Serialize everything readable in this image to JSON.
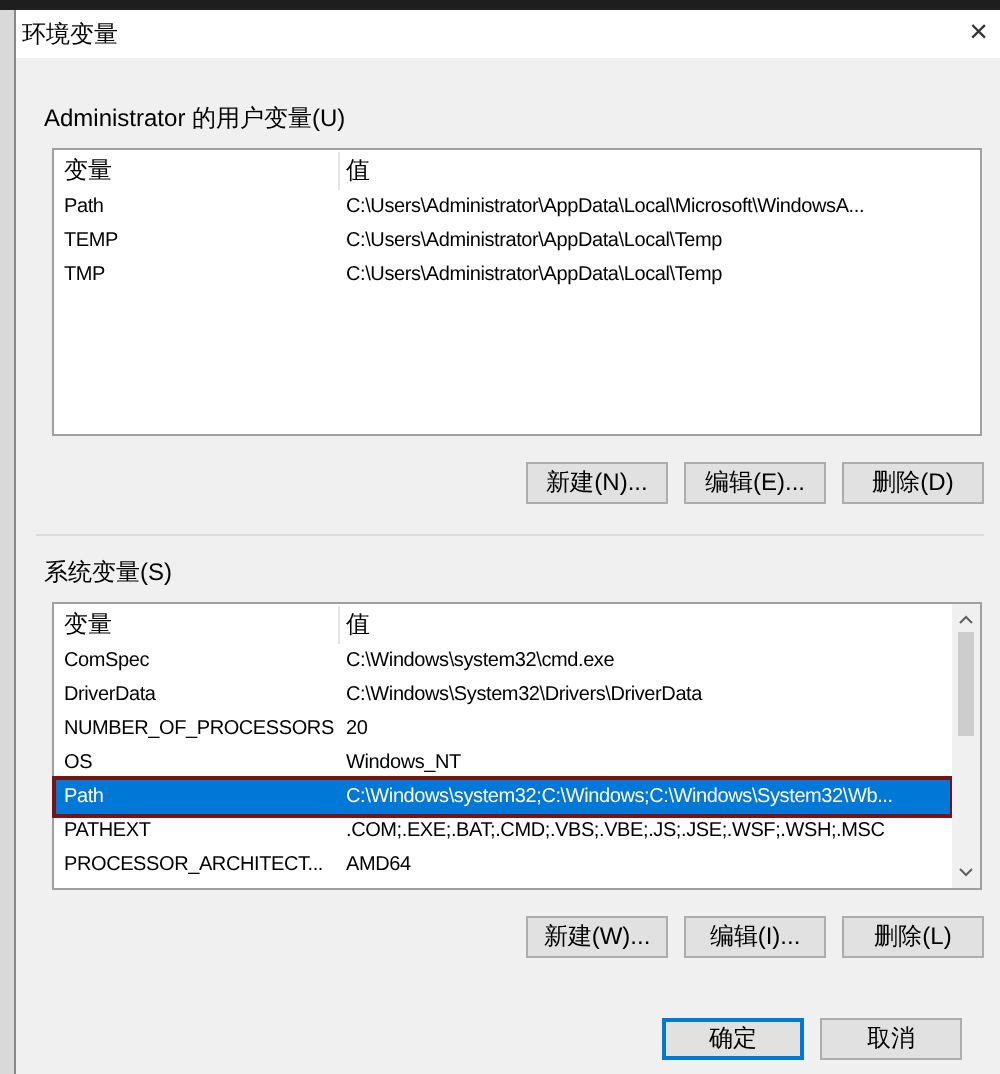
{
  "window": {
    "title": "环境变量",
    "close": "×"
  },
  "user_vars": {
    "title": "Administrator 的用户变量(U)",
    "columns": [
      "变量",
      "值"
    ],
    "rows": [
      {
        "name": "Path",
        "value": "C:\\Users\\Administrator\\AppData\\Local\\Microsoft\\WindowsA...",
        "selected": false,
        "outlined": false
      },
      {
        "name": "TEMP",
        "value": "C:\\Users\\Administrator\\AppData\\Local\\Temp",
        "selected": false,
        "outlined": false
      },
      {
        "name": "TMP",
        "value": "C:\\Users\\Administrator\\AppData\\Local\\Temp",
        "selected": false,
        "outlined": false
      }
    ],
    "buttons": [
      "新建(N)...",
      "编辑(E)...",
      "删除(D)"
    ]
  },
  "system_vars": {
    "title": "系统变量(S)",
    "columns": [
      "变量",
      "值"
    ],
    "rows": [
      {
        "name": "ComSpec",
        "value": "C:\\Windows\\system32\\cmd.exe",
        "selected": false,
        "outlined": false
      },
      {
        "name": "DriverData",
        "value": "C:\\Windows\\System32\\Drivers\\DriverData",
        "selected": false,
        "outlined": false
      },
      {
        "name": "NUMBER_OF_PROCESSORS",
        "value": "20",
        "selected": false,
        "outlined": false
      },
      {
        "name": "OS",
        "value": "Windows_NT",
        "selected": false,
        "outlined": false
      },
      {
        "name": "Path",
        "value": "C:\\Windows\\system32;C:\\Windows;C:\\Windows\\System32\\Wb...",
        "selected": true,
        "outlined": true
      },
      {
        "name": "PATHEXT",
        "value": ".COM;.EXE;.BAT;.CMD;.VBS;.VBE;.JS;.JSE;.WSF;.WSH;.MSC",
        "selected": false,
        "outlined": false
      },
      {
        "name": "PROCESSOR_ARCHITECT...",
        "value": "AMD64",
        "selected": false,
        "outlined": false
      }
    ],
    "buttons": [
      "新建(W)...",
      "编辑(I)...",
      "删除(L)"
    ]
  },
  "footer_buttons": [
    {
      "label": "确定",
      "default": true
    },
    {
      "label": "取消",
      "default": false
    }
  ]
}
